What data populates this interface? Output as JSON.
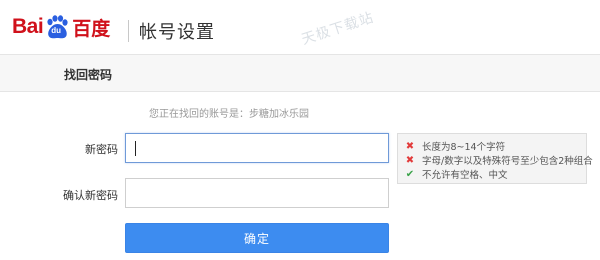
{
  "header": {
    "logo_text_latin": "Bai",
    "logo_paw_text": "du",
    "logo_text_cn": "百度",
    "title": "帐号设置",
    "watermark": "天极下载站"
  },
  "subbar": {
    "title": "找回密码"
  },
  "form": {
    "hint_prefix": "您正在找回的账号是：",
    "account_name": "步糖加冰乐园",
    "new_password_label": "新密码",
    "new_password_value": "",
    "confirm_password_label": "确认新密码",
    "confirm_password_value": "",
    "submit_label": "确定"
  },
  "password_rules": [
    {
      "status": "fail",
      "mark": "✖",
      "text": "长度为8~14个字符"
    },
    {
      "status": "fail",
      "mark": "✖",
      "text": "字母/数字以及特殊符号至少包含2种组合"
    },
    {
      "status": "pass",
      "mark": "✔",
      "text": "不允许有空格、中文"
    }
  ],
  "colors": {
    "brand_red": "#d0111b",
    "brand_blue": "#2a5fe0",
    "button_blue": "#3d8cf0",
    "rule_fail": "#e23b3b",
    "rule_pass": "#3ba34a"
  }
}
